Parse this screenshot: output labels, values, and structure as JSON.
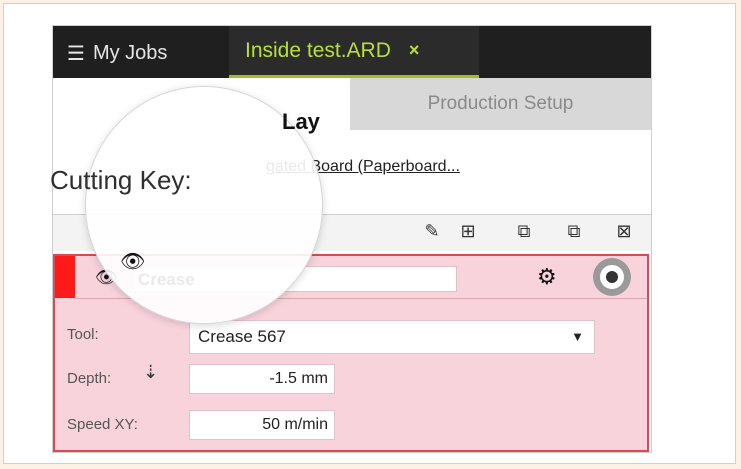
{
  "topbar": {
    "jobs_label": "My Jobs",
    "jobs_icon": "list-icon",
    "active_tab_label": "Inside test.ARD",
    "close_glyph": "×"
  },
  "subtabs": {
    "layout_label": "Lay",
    "production_label": "Production Setup"
  },
  "cutting_key": {
    "label": "Cutting Key:",
    "value": "gated Board (Paperboard..."
  },
  "toolbar": {
    "icons": [
      "pencil-icon",
      "add-icon",
      "copy-icon",
      "duplicate-icon",
      "delete-icon"
    ]
  },
  "layer": {
    "name": "Crease",
    "tool_label": "Tool:",
    "tool_value": "Crease 567",
    "depth_label": "Depth:",
    "depth_value": "-1.5 mm",
    "speed_label": "Speed XY:",
    "speed_value": "50 m/min"
  },
  "colors": {
    "accent_green": "#b9e03a",
    "layer_red": "#ff1a1a",
    "panel_pink": "#f8d3dc"
  }
}
